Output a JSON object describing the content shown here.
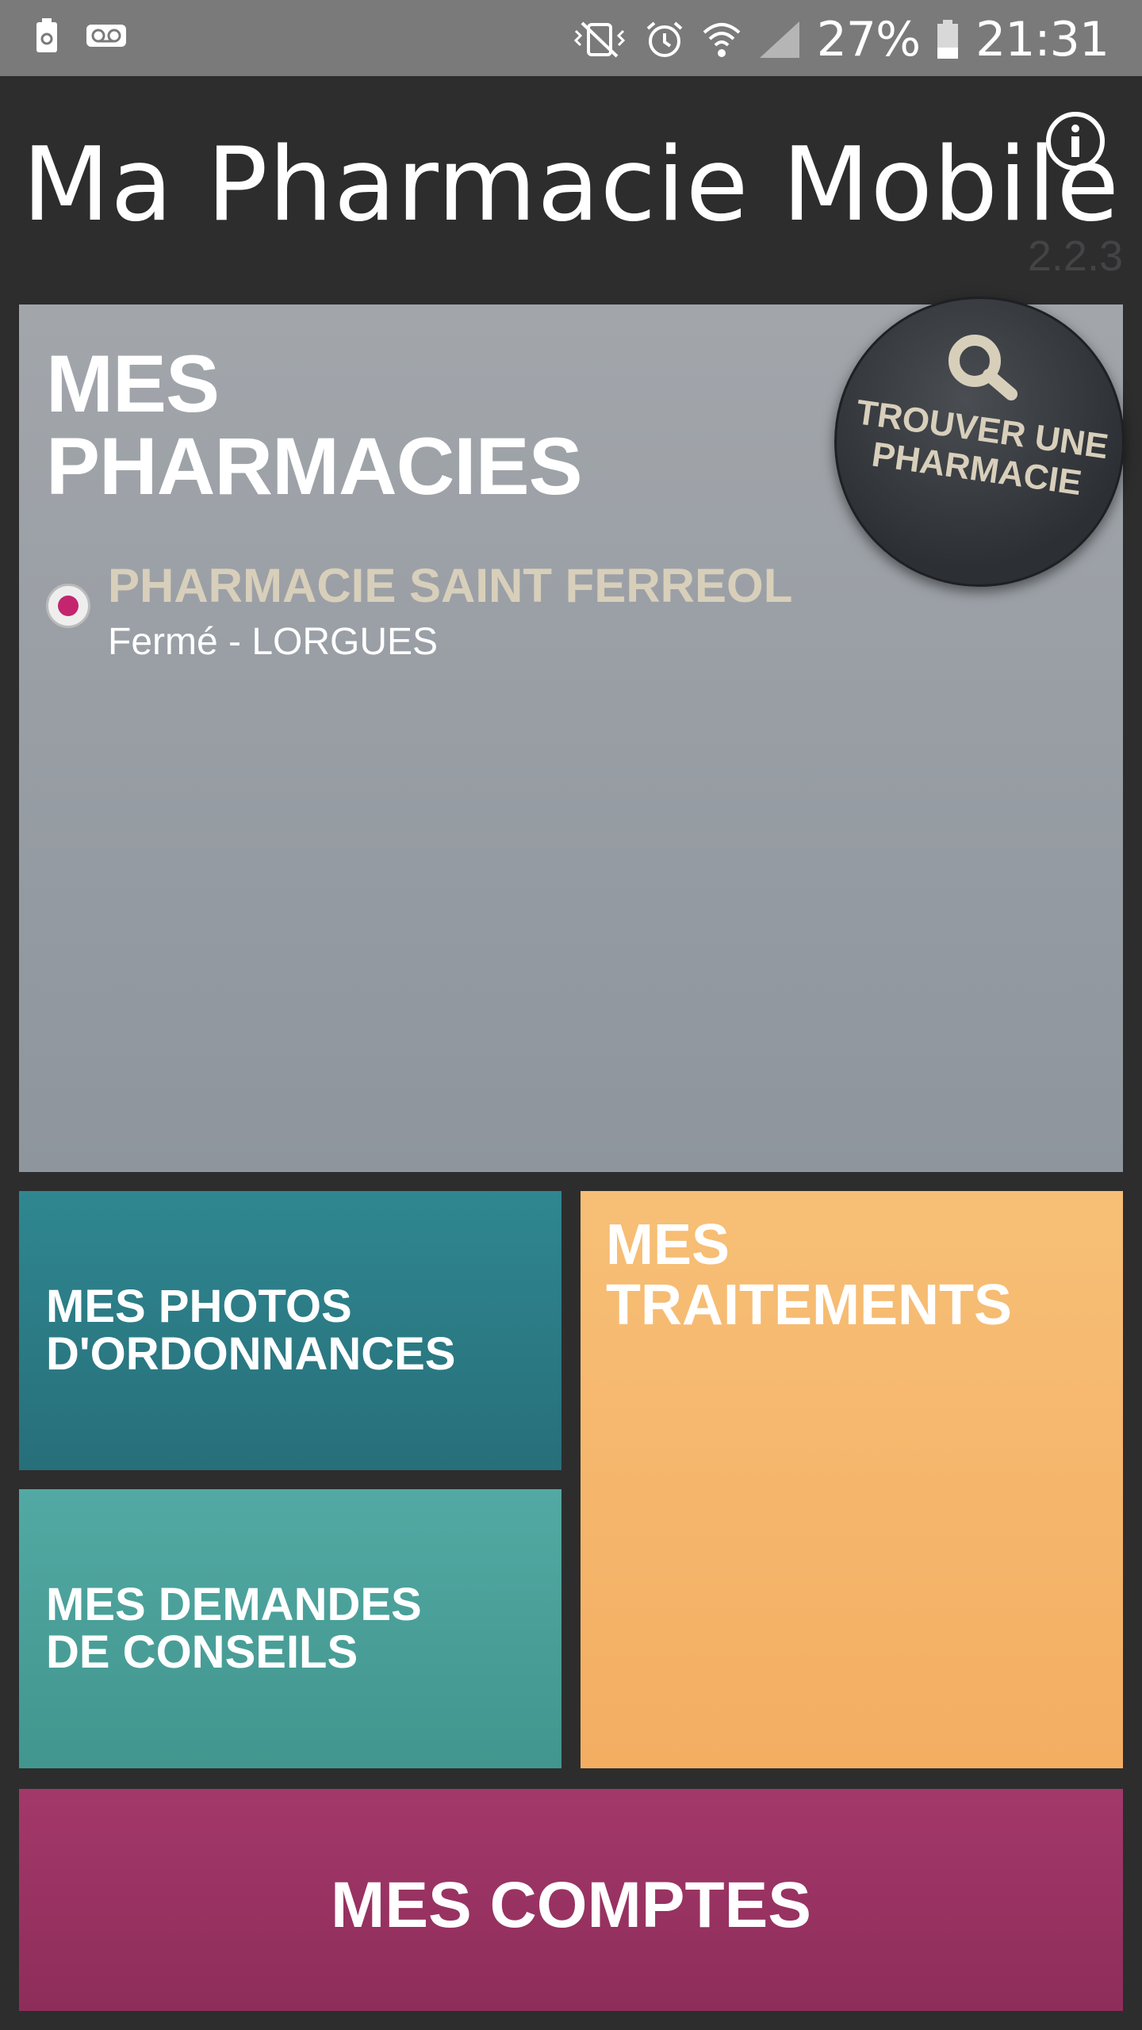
{
  "status_bar": {
    "icons": [
      "battery-saver-icon",
      "voicemail-icon",
      "vibrate-mute-icon",
      "alarm-icon",
      "wifi-icon",
      "signal-icon"
    ],
    "battery": "27%",
    "time": "21:31"
  },
  "header": {
    "title": "Ma Pharmacie Mobile",
    "version": "2.2.3",
    "info_icon": "info-icon"
  },
  "pharmacies": {
    "title_line1": "MES",
    "title_line2": "PHARMACIES",
    "find_button": {
      "icon": "search-icon",
      "line1": "TROUVER UNE",
      "line2": "PHARMACIE"
    },
    "items": [
      {
        "name": "PHARMACIE SAINT FERREOL",
        "status": "Fermé - LORGUES",
        "selected": true
      }
    ]
  },
  "tiles": {
    "photos": {
      "line1": "MES PHOTOS",
      "line2": "D'ORDONNANCES",
      "color": "#2b7d86"
    },
    "traitements": {
      "line1": "MES",
      "line2": "TRAITEMENTS",
      "color": "#f5b86c"
    },
    "conseils": {
      "line1": "MES DEMANDES",
      "line2": "DE CONSEILS",
      "color": "#4aa09a"
    },
    "comptes": {
      "label": "MES COMPTES",
      "color": "#9a3363"
    }
  },
  "colors": {
    "background": "#2d2d2e",
    "accent_pink": "#c3266e",
    "pharmacy_name": "#d8cfbb"
  }
}
